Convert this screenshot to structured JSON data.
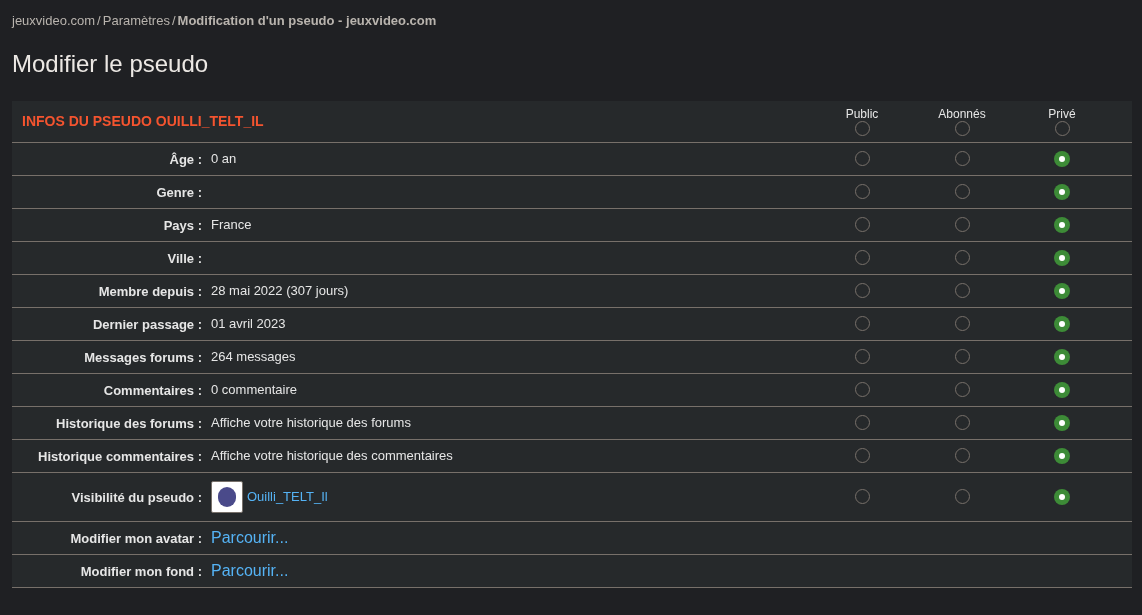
{
  "breadcrumb_separator": "/",
  "breadcrumb": [
    {
      "label": "jeuxvideo.com",
      "current": false
    },
    {
      "label": "Paramètres",
      "current": false
    },
    {
      "label": "Modification d'un pseudo - jeuxvideo.com",
      "current": true
    }
  ],
  "title": "Modifier le pseudo",
  "table": {
    "heading": "INFOS DU PSEUDO OUILLI_TELT_IL",
    "columns": [
      {
        "label": "Public",
        "selected": false
      },
      {
        "label": "Abonnés",
        "selected": false
      },
      {
        "label": "Privé",
        "selected": false
      }
    ],
    "rows": [
      {
        "kind": "text",
        "label": "Âge :",
        "value": "0 an",
        "visibility": [
          false,
          false,
          true
        ]
      },
      {
        "kind": "text",
        "label": "Genre :",
        "visibility": [
          false,
          false,
          true
        ]
      },
      {
        "kind": "text",
        "label": "Pays :",
        "value": "France",
        "visibility": [
          false,
          false,
          true
        ]
      },
      {
        "kind": "text",
        "label": "Ville :",
        "visibility": [
          false,
          false,
          true
        ]
      },
      {
        "kind": "text",
        "label": "Membre depuis :",
        "value": "28 mai 2022 (307 jours)",
        "visibility": [
          false,
          false,
          true
        ]
      },
      {
        "kind": "text",
        "label": "Dernier passage :",
        "value": "01 avril 2023",
        "visibility": [
          false,
          false,
          true
        ]
      },
      {
        "kind": "text",
        "label": "Messages forums :",
        "value": "264 messages",
        "visibility": [
          false,
          false,
          true
        ]
      },
      {
        "kind": "text",
        "label": "Commentaires :",
        "value": "0 commentaire",
        "visibility": [
          false,
          false,
          true
        ]
      },
      {
        "kind": "text",
        "label": "Historique des forums :",
        "value": "Affiche votre historique des forums",
        "visibility": [
          false,
          false,
          true
        ]
      },
      {
        "kind": "text",
        "label": "Historique commentaires :",
        "value": "Affiche votre historique des commentaires",
        "visibility": [
          false,
          false,
          true
        ]
      },
      {
        "kind": "avatar",
        "label": "Visibilité du pseudo :",
        "value": "Ouilli_TELT_Il",
        "visibility": [
          false,
          false,
          true
        ]
      },
      {
        "kind": "file",
        "label": "Modifier mon avatar :",
        "value": "Parcourir..."
      },
      {
        "kind": "file",
        "label": "Modifier mon fond :",
        "value": "Parcourir..."
      }
    ]
  }
}
